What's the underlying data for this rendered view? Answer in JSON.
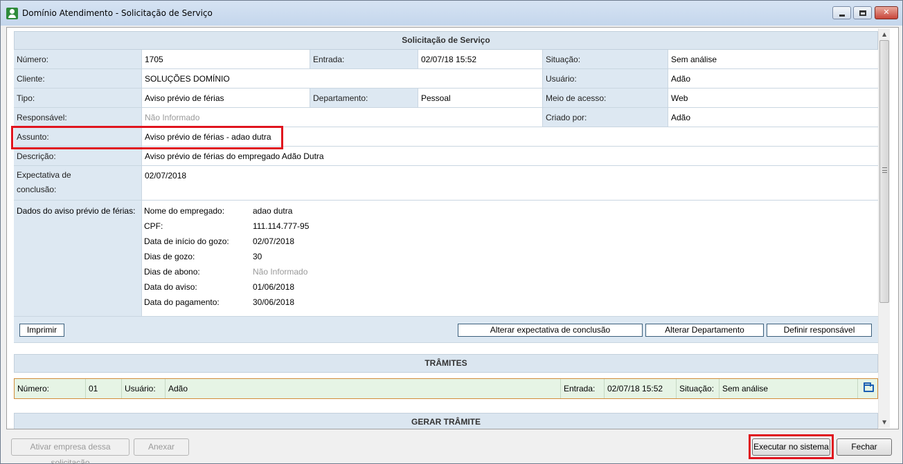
{
  "window": {
    "title": "Domínio Atendimento - Solicitação de Serviço",
    "min_glyph": "—",
    "close_glyph": "✕"
  },
  "solicitacao": {
    "header": "Solicitação de Serviço",
    "numero_label": "Número:",
    "numero": "1705",
    "entrada_label": "Entrada:",
    "entrada": "02/07/18 15:52",
    "situacao_label": "Situação:",
    "situacao": "Sem análise",
    "cliente_label": "Cliente:",
    "cliente": "SOLUÇÕES DOMÍNIO",
    "usuario_label": "Usuário:",
    "usuario": "Adão",
    "tipo_label": "Tipo:",
    "tipo": "Aviso prévio de férias",
    "departamento_label": "Departamento:",
    "departamento": "Pessoal",
    "meio_label": "Meio de acesso:",
    "meio": "Web",
    "responsavel_label": "Responsável:",
    "responsavel": "Não Informado",
    "criado_label": "Criado por:",
    "criado": "Adão",
    "assunto_label": "Assunto:",
    "assunto": "Aviso prévio de férias - adao dutra",
    "descricao_label": "Descrição:",
    "descricao": "Aviso prévio de férias do empregado Adão Dutra",
    "expectativa_label_1": "Expectativa de",
    "expectativa_label_2": "conclusão:",
    "expectativa": "02/07/2018",
    "dados_label": "Dados do aviso prévio de férias:",
    "dados": [
      {
        "key": "Nome do empregado:",
        "value": "adao dutra"
      },
      {
        "key": "CPF:",
        "value": "111.114.777-95"
      },
      {
        "key": "Data de início do gozo:",
        "value": "02/07/2018"
      },
      {
        "key": "Dias de gozo:",
        "value": "30"
      },
      {
        "key": "Dias de abono:",
        "value": "Não Informado"
      },
      {
        "key": "Data do aviso:",
        "value": "01/06/2018"
      },
      {
        "key": "Data do pagamento:",
        "value": "30/06/2018"
      }
    ]
  },
  "actions": {
    "imprimir": "Imprimir",
    "alterar_expectativa": "Alterar expectativa de conclusão",
    "alterar_departamento": "Alterar Departamento",
    "definir_responsavel": "Definir responsável"
  },
  "tramites": {
    "header": "TRÂMITES",
    "numero_label": "Número:",
    "numero": "01",
    "usuario_label": "Usuário:",
    "usuario": "Adão",
    "entrada_label": "Entrada:",
    "entrada": "02/07/18 15:52",
    "situacao_label": "Situação:",
    "situacao": "Sem análise"
  },
  "gerar": {
    "header": "GERAR TRÂMITE"
  },
  "footer": {
    "ativar": "Ativar empresa dessa solicitação",
    "anexar": "Anexar",
    "executar": "Executar no sistema",
    "fechar": "Fechar"
  },
  "colors": {
    "highlight": "#e0141e",
    "label_bg": "#dde8f2",
    "tramite_bg": "#e6f4e5"
  }
}
